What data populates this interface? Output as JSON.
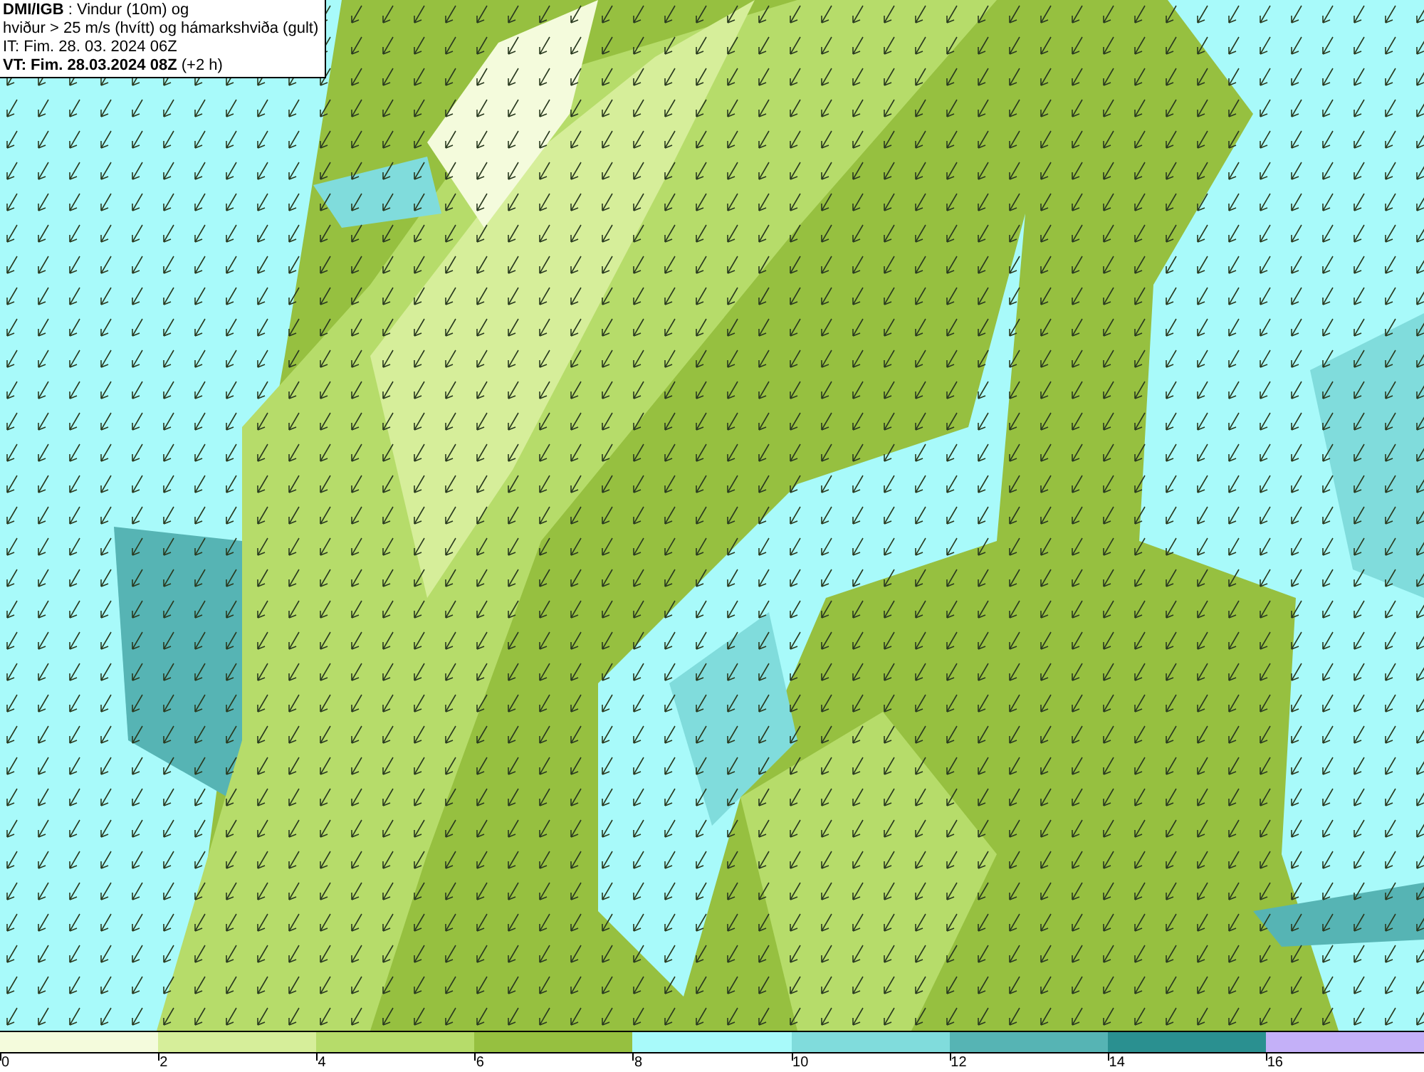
{
  "header": {
    "lines": [
      "**DMI/IGB** : Vindur (10m) og",
      "hviður > 25 m/s (hvítt) og hámarkshviða (gult)",
      "IT: Fim. 28. 03. 2024 06Z",
      "**VT: Fim. 28.03.2024 08Z** (+2 h)"
    ]
  },
  "legend": [
    {
      "label": "0",
      "color": "#f4fbdc"
    },
    {
      "label": "2",
      "color": "#d6ee9a"
    },
    {
      "label": "4",
      "color": "#b6dc6a"
    },
    {
      "label": "6",
      "color": "#96c040"
    },
    {
      "label": "8",
      "color": "#a8fafa"
    },
    {
      "label": "10",
      "color": "#80dcdc"
    },
    {
      "label": "12",
      "color": "#56b4b4"
    },
    {
      "label": "14",
      "color": "#2a9090"
    },
    {
      "label": "16",
      "color": "#c4b0f8"
    }
  ]
}
